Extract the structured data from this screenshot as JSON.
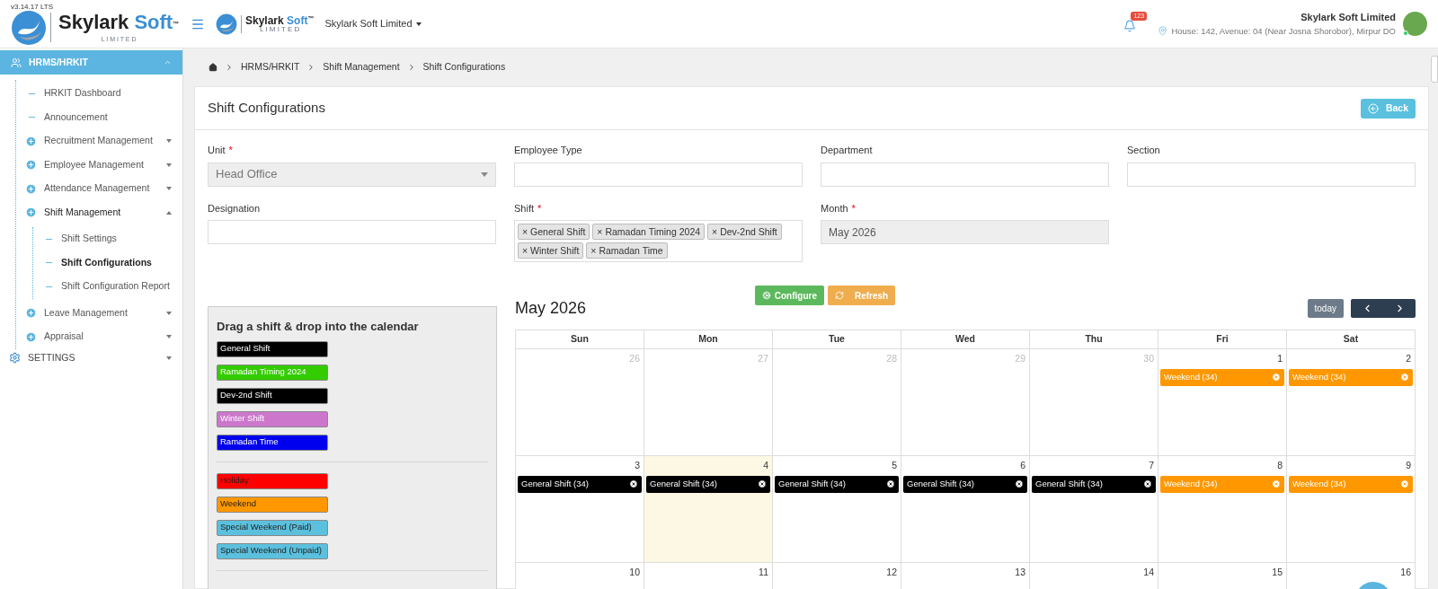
{
  "header": {
    "version": "v3.14.17 LTS",
    "logo": {
      "name": "Skylark",
      "accent": "Soft",
      "tm": "™",
      "sub": "L I M I T E D"
    },
    "small_logo": {
      "name": "Skylark",
      "accent": "Soft",
      "tm": "™",
      "sub": "L I M I T E D"
    },
    "company_menu": "Skylark Soft Limited",
    "notification_count": "123",
    "profile": {
      "name": "Skylark Soft Limited",
      "address": "House: 142, Avenue: 04 (Near Josna Shorobor), Mirpur DO",
      "online": true
    }
  },
  "sidebar": {
    "section": {
      "label": "HRMS/HRKIT",
      "expanded": true
    },
    "items": [
      {
        "label": "HRKIT Dashboard",
        "kind": "leaf",
        "selected": false
      },
      {
        "label": "Announcement",
        "kind": "leaf",
        "selected": false
      },
      {
        "label": "Recruitment Management",
        "kind": "group",
        "expanded": false
      },
      {
        "label": "Employee Management",
        "kind": "group",
        "expanded": false
      },
      {
        "label": "Attendance Management",
        "kind": "group",
        "expanded": false
      },
      {
        "label": "Shift Management",
        "kind": "group",
        "expanded": true,
        "children": [
          {
            "label": "Shift Settings",
            "selected": false
          },
          {
            "label": "Shift Configurations",
            "selected": true
          },
          {
            "label": "Shift Configuration Report",
            "selected": false
          }
        ]
      },
      {
        "label": "Leave Management",
        "kind": "group",
        "expanded": false
      },
      {
        "label": "Appraisal",
        "kind": "group",
        "expanded": false
      }
    ],
    "settings": {
      "label": "SETTINGS",
      "expanded": false
    }
  },
  "breadcrumb": [
    "HRMS/HRKIT",
    "Shift Management",
    "Shift Configurations"
  ],
  "page_title": "Shift Configurations",
  "back_button": "Back",
  "fields": [
    {
      "label": "Unit",
      "required_mark": "*",
      "kind": "select",
      "value": "Head Office",
      "disabled": true
    },
    {
      "label": "Employee Type",
      "kind": "text"
    },
    {
      "label": "Department",
      "kind": "text"
    },
    {
      "label": "Section",
      "kind": "text"
    },
    {
      "label": "Designation",
      "kind": "text"
    },
    {
      "label": "Shift",
      "required_mark": "*",
      "kind": "tags",
      "remove_symbol": "×",
      "tags": [
        "General Shift",
        "Ramadan Timing 2024",
        "Dev-2nd Shift",
        "Winter Shift",
        "Ramadan Time"
      ]
    },
    {
      "label": "Month",
      "required_mark": "*",
      "kind": "text",
      "value": "May 2026",
      "disabled": true
    }
  ],
  "actions": {
    "configure": "Configure",
    "refresh": "Refresh"
  },
  "palette": {
    "title": "Drag a shift & drop into the calendar",
    "shifts": [
      {
        "label": "General Shift",
        "color": "#000000"
      },
      {
        "label": "Ramadan Timing 2024",
        "color": "#33cc00"
      },
      {
        "label": "Dev-2nd Shift",
        "color": "#000000"
      },
      {
        "label": "Winter Shift",
        "color": "#cc77cc"
      },
      {
        "label": "Ramadan Time",
        "color": "#0000ee"
      }
    ],
    "day_types": [
      {
        "label": "Holiday",
        "color": "#ff0000"
      },
      {
        "label": "Weekend",
        "color": "#ff9800"
      },
      {
        "label": "Special Weekend (Paid)",
        "color": "#5bc0de"
      },
      {
        "label": "Special Weekend (Unpaid)",
        "color": "#5bc0de"
      }
    ]
  },
  "calendar": {
    "title": "May 2026",
    "today_button": "today",
    "weekdays": [
      "Sun",
      "Mon",
      "Tue",
      "Wed",
      "Thu",
      "Fri",
      "Sat"
    ],
    "weeks": [
      [
        {
          "day": "26",
          "other_month": true,
          "today": false
        },
        {
          "day": "27",
          "other_month": true,
          "today": false
        },
        {
          "day": "28",
          "other_month": true,
          "today": false
        },
        {
          "day": "29",
          "other_month": true,
          "today": false
        },
        {
          "day": "30",
          "other_month": true,
          "today": false
        },
        {
          "day": "1",
          "other_month": false,
          "today": false,
          "events": [
            {
              "label": "Weekend (34)",
              "color": "#ff9800"
            }
          ]
        },
        {
          "day": "2",
          "other_month": false,
          "today": false,
          "events": [
            {
              "label": "Weekend (34)",
              "color": "#ff9800"
            }
          ]
        }
      ],
      [
        {
          "day": "3",
          "other_month": false,
          "today": false,
          "events": [
            {
              "label": "General Shift (34)",
              "color": "#000000"
            }
          ]
        },
        {
          "day": "4",
          "other_month": false,
          "today": true,
          "events": [
            {
              "label": "General Shift (34)",
              "color": "#000000"
            }
          ]
        },
        {
          "day": "5",
          "other_month": false,
          "today": false,
          "events": [
            {
              "label": "General Shift (34)",
              "color": "#000000"
            }
          ]
        },
        {
          "day": "6",
          "other_month": false,
          "today": false,
          "events": [
            {
              "label": "General Shift (34)",
              "color": "#000000"
            }
          ]
        },
        {
          "day": "7",
          "other_month": false,
          "today": false,
          "events": [
            {
              "label": "General Shift (34)",
              "color": "#000000"
            }
          ]
        },
        {
          "day": "8",
          "other_month": false,
          "today": false,
          "events": [
            {
              "label": "Weekend (34)",
              "color": "#ff9800"
            }
          ]
        },
        {
          "day": "9",
          "other_month": false,
          "today": false,
          "events": [
            {
              "label": "Weekend (34)",
              "color": "#ff9800"
            }
          ]
        }
      ],
      [
        {
          "day": "10",
          "other_month": false,
          "today": false
        },
        {
          "day": "11",
          "other_month": false,
          "today": false
        },
        {
          "day": "12",
          "other_month": false,
          "today": false
        },
        {
          "day": "13",
          "other_month": false,
          "today": false
        },
        {
          "day": "14",
          "other_month": false,
          "today": false
        },
        {
          "day": "15",
          "other_month": false,
          "today": false
        },
        {
          "day": "16",
          "other_month": false,
          "today": false
        }
      ]
    ]
  }
}
